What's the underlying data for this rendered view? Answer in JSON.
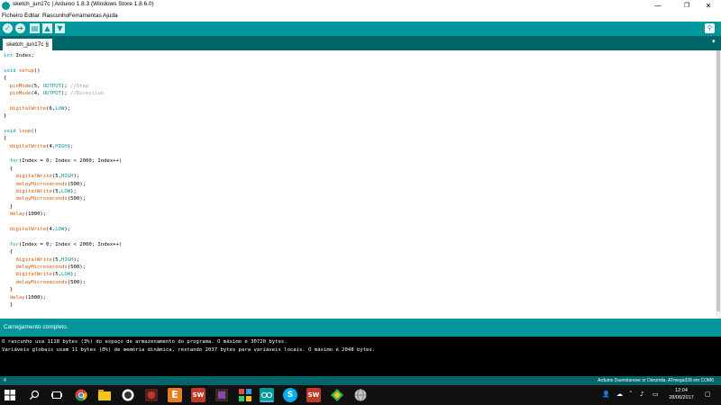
{
  "window": {
    "title": "sketch_jun17c | Arduino 1.8.3 (Windows Store 1.8.6.0)",
    "minimize": "—",
    "maximize": "❐",
    "close": "✕"
  },
  "menu": {
    "items": [
      "Ficheiro",
      "Editar",
      "Rascunho",
      "Ferramentas",
      "Ajuda"
    ]
  },
  "toolbar": {
    "verify_icon": "check-icon",
    "upload_icon": "arrow-right-icon",
    "new_icon": "new-file-icon",
    "open_icon": "arrow-up-icon",
    "save_icon": "arrow-down-icon",
    "serial_monitor_icon": "magnifier-icon",
    "verify_glyph": "✓",
    "upload_glyph": "➔",
    "new_glyph": "▤",
    "open_glyph": "▲",
    "save_glyph": "▼",
    "serial_glyph": "⚲"
  },
  "tabs": {
    "active": "sketch_jun17c §",
    "menu_glyph": "▾"
  },
  "editor": {
    "lines": [
      "int Index;",
      "",
      "void setup()",
      "{",
      "  pinMode(5, OUTPUT); //Step",
      "  pinMode(4, OUTPUT); //Direction",
      "",
      "  digitalWrite(6,LOW);",
      "}",
      "",
      "void loop()",
      "{",
      "  digitalWrite(4,HIGH);",
      "",
      "  for(Index = 0; Index < 2000; Index++)",
      "  {",
      "    digitalWrite(5,HIGH);",
      "    delayMicroseconds(500);",
      "    digitalWrite(5,LOW);",
      "    delayMicroseconds(500);",
      "  }",
      "  delay(1000);",
      "",
      "  digitalWrite(4,LOW);",
      "",
      "  for(Index = 0; Index < 2000; Index++)",
      "  {",
      "    digitalWrite(5,HIGH);",
      "    delayMicroseconds(500);",
      "    digitalWrite(5,LOW);",
      "    delayMicroseconds(500);",
      "  }",
      "  delay(1000);",
      "  }"
    ]
  },
  "status": {
    "message": "Carregamento completo."
  },
  "console": {
    "lines": [
      "O rascunho usa 1118 bytes (3%) do espaço de armazenamento do programa. O máximo é 30720 bytes.",
      "Variáveis globais usam 11 bytes (0%) de memória dinâmica, restando 2037 bytes para variáveis locais. O máximo é 2048 bytes."
    ]
  },
  "footer": {
    "line_number": "4",
    "board": "Arduino Duemilanove or Diecimila, ATmega328 em COM6"
  },
  "taskbar": {
    "time": "12:04",
    "date": "28/06/2017",
    "colors": {
      "chrome": "#4285f4",
      "explorer": "#f5c518",
      "github": "#333333",
      "app_red": "#c0392b",
      "app_orange": "#e67e22",
      "arduino": "#00979c",
      "skype": "#00aff0"
    }
  },
  "colors": {
    "accent": "#00979c",
    "tabbar": "#006468",
    "keyword": "#00979c",
    "function": "#d35400",
    "comment": "#95a5a6"
  }
}
